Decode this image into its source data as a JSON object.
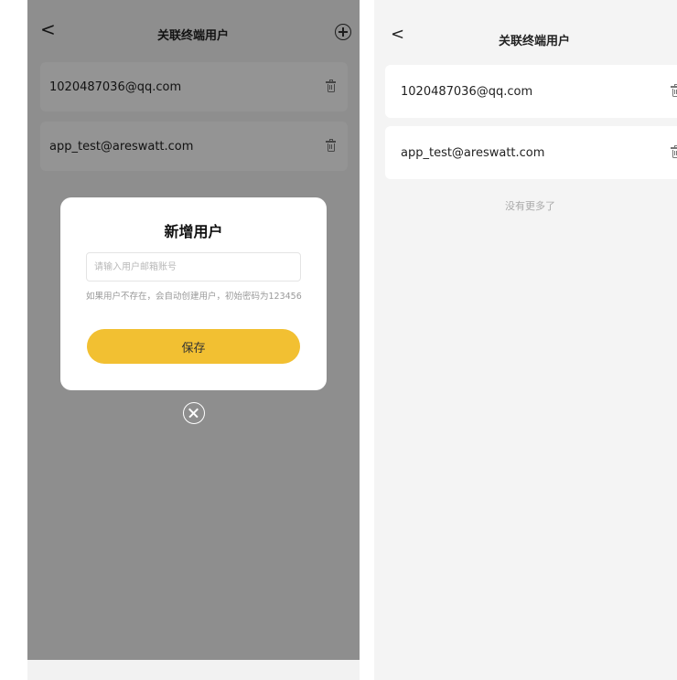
{
  "left_screen": {
    "nav": {
      "back_glyph": "<",
      "title": "关联终端用户",
      "add_icon": "plus-circle-icon"
    },
    "users": [
      {
        "email": "1020487036@qq.com",
        "delete_icon": "trash-icon"
      },
      {
        "email": "app_test@areswatt.com",
        "delete_icon": "trash-icon"
      }
    ],
    "dialog": {
      "title": "新增用户",
      "input_placeholder": "请输入用户邮箱账号",
      "input_value": "",
      "hint": "如果用户不存在，会自动创建用户，初始密码为123456",
      "save_label": "保存",
      "close_icon": "close-circle-icon"
    },
    "overlay_color": "#000000",
    "accent_color": "#f2c032"
  },
  "right_screen": {
    "nav": {
      "back_glyph": "<",
      "title": "关联终端用户"
    },
    "users": [
      {
        "email": "1020487036@qq.com",
        "delete_icon": "trash-icon"
      },
      {
        "email": "app_test@areswatt.com",
        "delete_icon": "trash-icon"
      }
    ],
    "list_footer": "没有更多了"
  }
}
